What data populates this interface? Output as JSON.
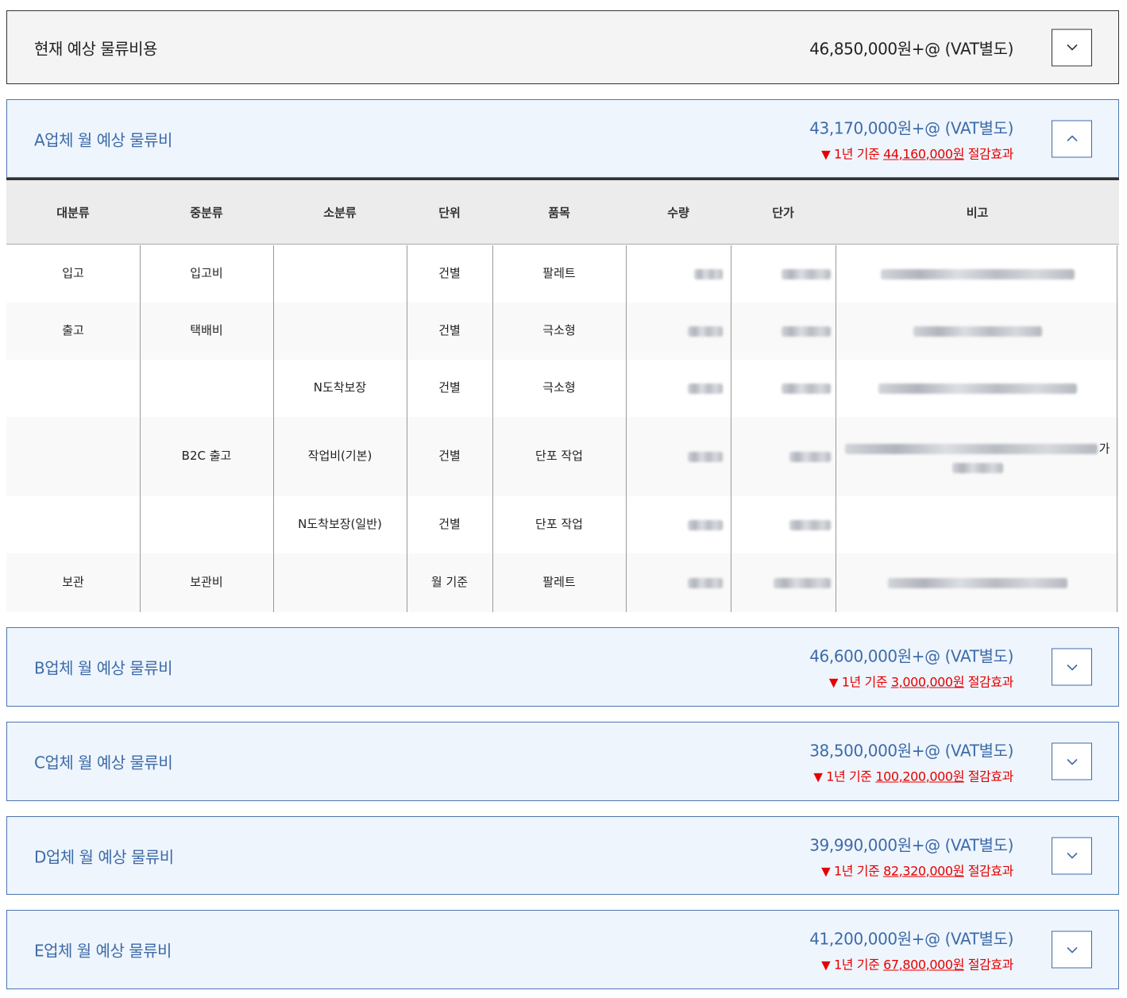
{
  "current": {
    "title": "현재 예상 물류비용",
    "amount": "46,850,000원+@ (VAT별도)"
  },
  "vendors": [
    {
      "title": "A업체 월 예상 물류비",
      "amount": "43,170,000원+@ (VAT별도)",
      "saving_prefix": "1년 기준 ",
      "saving_value": "44,160,000원",
      "saving_suffix": " 절감효과",
      "expanded": true
    },
    {
      "title": "B업체 월 예상 물류비",
      "amount": "46,600,000원+@ (VAT별도)",
      "saving_prefix": "1년 기준 ",
      "saving_value": "3,000,000원",
      "saving_suffix": " 절감효과",
      "expanded": false
    },
    {
      "title": "C업체 월 예상 물류비",
      "amount": "38,500,000원+@ (VAT별도)",
      "saving_prefix": "1년 기준 ",
      "saving_value": "100,200,000원",
      "saving_suffix": " 절감효과",
      "expanded": false
    },
    {
      "title": "D업체 월 예상 물류비",
      "amount": "39,990,000원+@ (VAT별도)",
      "saving_prefix": "1년 기준 ",
      "saving_value": "82,320,000원",
      "saving_suffix": " 절감효과",
      "expanded": false
    },
    {
      "title": "E업체 월 예상 물류비",
      "amount": "41,200,000원+@ (VAT별도)",
      "saving_prefix": "1년 기준 ",
      "saving_value": "67,800,000원",
      "saving_suffix": " 절감효과",
      "expanded": false
    }
  ],
  "table": {
    "headers": [
      "대분류",
      "중분류",
      "소분류",
      "단위",
      "품목",
      "수량",
      "단가",
      "비고"
    ],
    "rows": [
      {
        "major": "입고",
        "middle": "입고비",
        "minor": "",
        "unit": "건별",
        "item": "팔레트"
      },
      {
        "major": "출고",
        "middle": "택배비",
        "minor": "",
        "unit": "건별",
        "item": "극소형"
      },
      {
        "major": "",
        "middle": "",
        "minor": "N도착보장",
        "unit": "건별",
        "item": "극소형"
      },
      {
        "major": "",
        "middle": "B2C 출고",
        "minor": "작업비(기본)",
        "unit": "건별",
        "item": "단포 작업",
        "note_tail": "가"
      },
      {
        "major": "",
        "middle": "",
        "minor": "N도착보장(일반)",
        "unit": "건별",
        "item": "단포 작업"
      },
      {
        "major": "보관",
        "middle": "보관비",
        "minor": "",
        "unit": "월 기준",
        "item": "팔레트"
      }
    ]
  },
  "icons": {
    "toggle_collapsed": "chevron-down-icon",
    "toggle_expanded": "chevron-up-icon",
    "saving_marker": "triangle-down-icon"
  },
  "colors": {
    "vendor_accent": "#3d6ba8",
    "vendor_bg": "#eef5fd",
    "saving_red": "#e60000"
  }
}
